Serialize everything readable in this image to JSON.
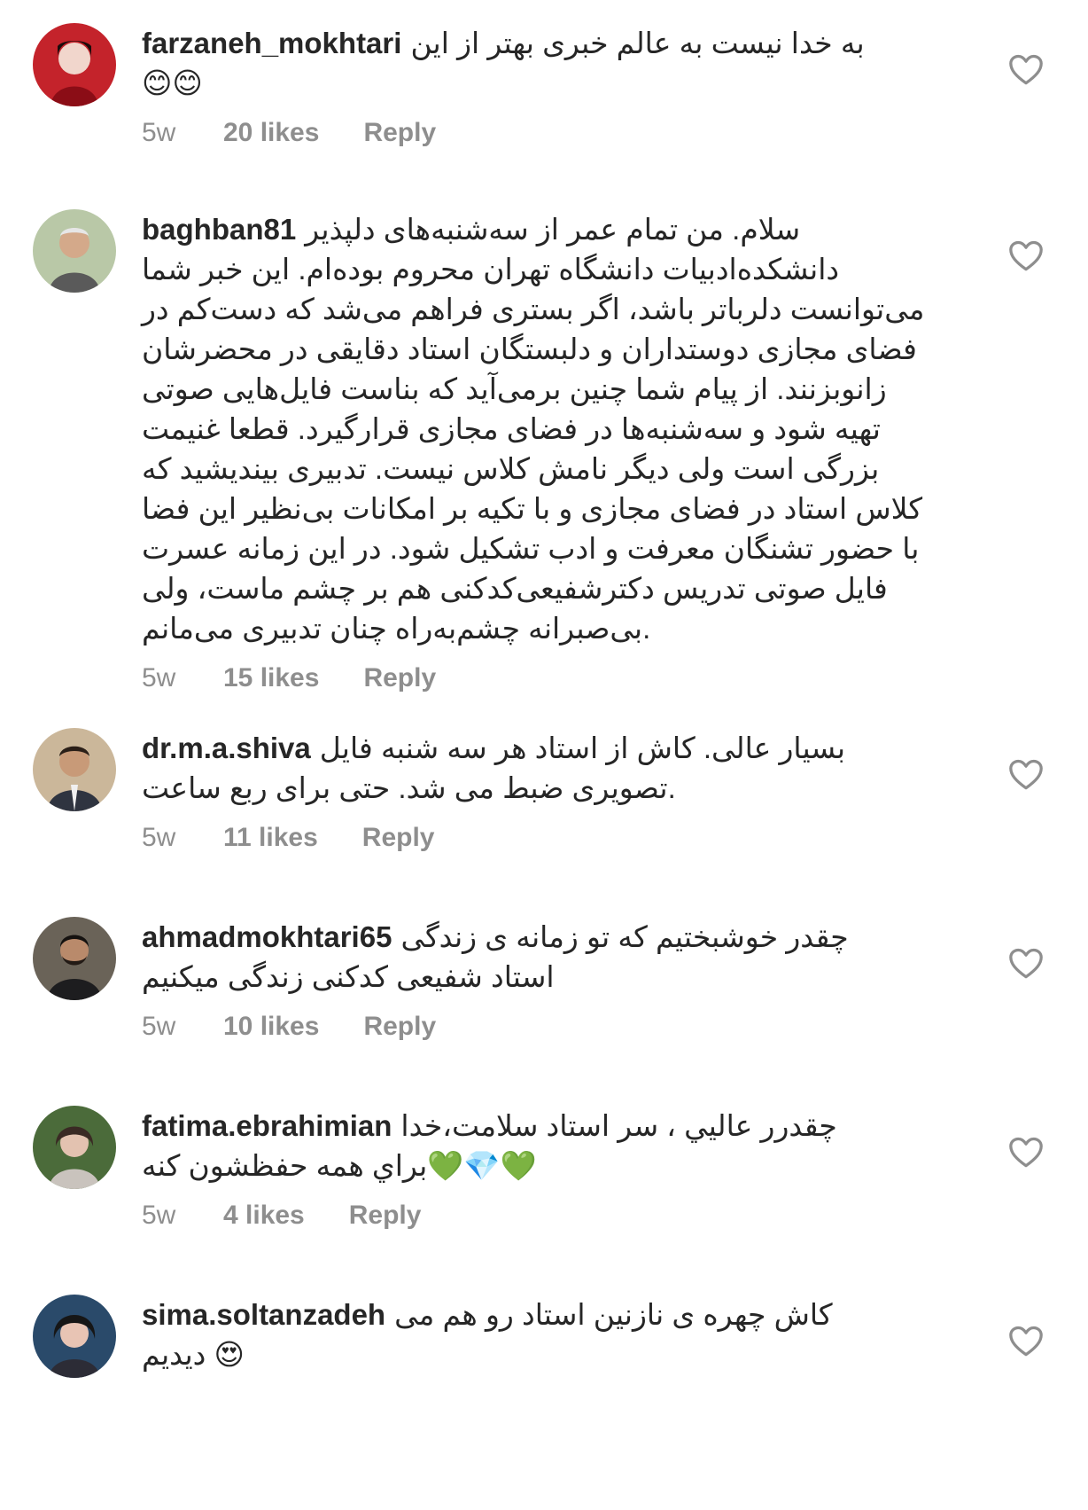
{
  "comments": [
    {
      "username": "farzaneh_mokhtari",
      "text": "به خدا نیست به عالم خبری بهتر از این\n😊😊",
      "time": "5w",
      "likes": "20 likes",
      "reply": "Reply"
    },
    {
      "username": "baghban81",
      "text": "سلام. من تمام عمر از سه‌شنبه‌های دلپذیر\nدانشکده‌ادبیات دانشگاه تهران محروم بوده‌ام. این خبر شما\nمی‌توانست دلرباتر باشد، اگر بستری فراهم می‌شد که دست‌کم در\nفضای مجازی دوستداران و دلبستگان استاد دقایقی در محضرشان\nزانوبزنند. از پیام شما چنین برمی‌آید که بناست فایل‌هایی صوتی\nتهیه شود و سه‌شنبه‌ها در فضای مجازی قرارگیرد. قطعا غنیمت\nبزرگی است ولی دیگر نامش کلاس نیست. تدبیری بیندیشید که\nکلاس استاد در فضای مجازی و با تکیه بر امکانات بی‌نظیر این فضا\nبا حضور تشنگان معرفت و ادب تشکیل شود. در این زمانه عسرت\nفایل صوتی تدریس دکترشفیعی‌کدکنی هم بر چشم ماست، ولی\nبی‌صبرانه چشم‌به‌راه چنان تدبیری می‌مانم.",
      "time": "5w",
      "likes": "15 likes",
      "reply": "Reply"
    },
    {
      "username": "dr.m.a.shiva",
      "text": "بسیار عالی. کاش از استاد هر سه شنبه فایل\nتصویری ضبط می شد. حتی برای ربع ساعت.",
      "time": "5w",
      "likes": "11 likes",
      "reply": "Reply"
    },
    {
      "username": "ahmadmokhtari65",
      "text": "چقدر خوشبختیم که تو زمانه ی زندگی\nاستاد شفیعی کدکنی زندگی میکنیم",
      "time": "5w",
      "likes": "10 likes",
      "reply": "Reply"
    },
    {
      "username": "fatima.ebrahimian",
      "text": "چقدرر عاليي ، سر استاد سلامت،خدا\nبراي همه حفظشون كنه💚💎💚",
      "time": "5w",
      "likes": "4 likes",
      "reply": "Reply"
    },
    {
      "username": "sima.soltanzadeh",
      "text": "کاش چهره ی نازنین استاد رو هم می\nدیدیم 😍",
      "time": "",
      "likes": "",
      "reply": ""
    }
  ],
  "icons": {
    "like": "heart-outline-icon",
    "avatar": "avatar"
  },
  "colors": {
    "text": "#262626",
    "meta": "#8e8e8e",
    "background": "#ffffff"
  }
}
